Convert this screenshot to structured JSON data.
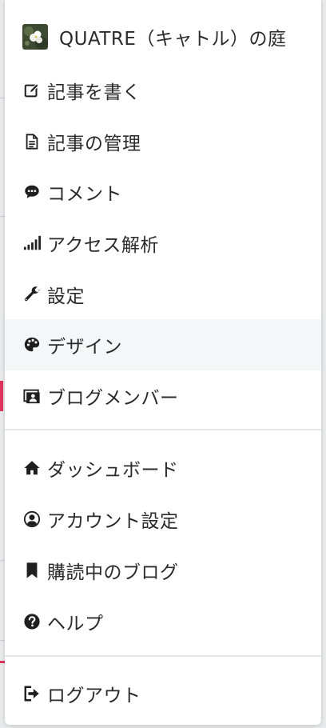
{
  "menu": {
    "blog_title": "QUATRE（キャトル）の庭",
    "items": [
      {
        "label": "記事を書く",
        "icon": "pencil-square-icon"
      },
      {
        "label": "記事の管理",
        "icon": "document-icon"
      },
      {
        "label": "コメント",
        "icon": "comment-bubble-icon"
      },
      {
        "label": "アクセス解析",
        "icon": "signal-bars-icon"
      },
      {
        "label": "設定",
        "icon": "wrench-icon"
      },
      {
        "label": "デザイン",
        "icon": "palette-icon"
      },
      {
        "label": "ブログメンバー",
        "icon": "members-icon"
      }
    ],
    "account_items": [
      {
        "label": "ダッシュボード",
        "icon": "home-icon"
      },
      {
        "label": "アカウント設定",
        "icon": "user-circle-icon"
      },
      {
        "label": "購読中のブログ",
        "icon": "bookmark-icon"
      },
      {
        "label": "ヘルプ",
        "icon": "question-circle-icon"
      }
    ],
    "logout_label": "ログアウト"
  },
  "colors": {
    "text": "#2b2b2b",
    "hover_bg": "#f5f6f7",
    "divider": "#e6e7e9",
    "accent": "#e0335a"
  }
}
